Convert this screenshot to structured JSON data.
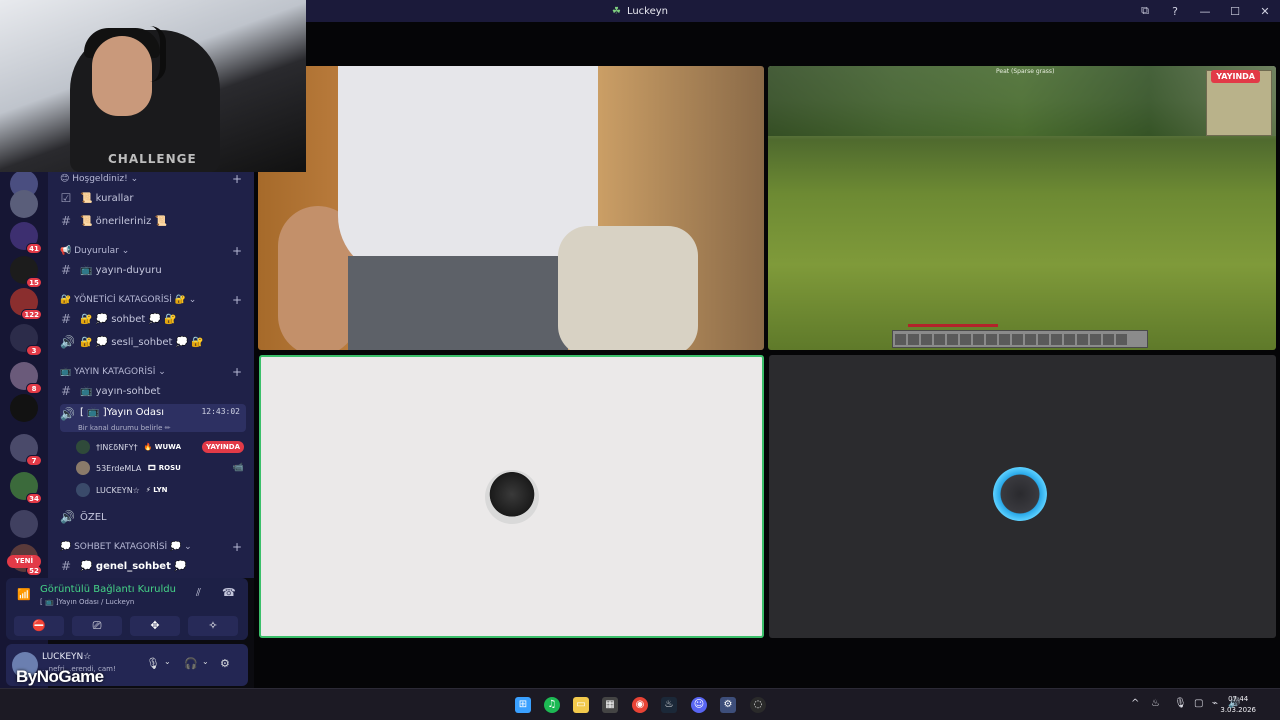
{
  "window": {
    "title": "Luckeyn",
    "controls": [
      "⧉",
      "?",
      "—",
      "☐",
      "✕"
    ]
  },
  "guilds": [
    {
      "badge": ""
    },
    {
      "badge": ""
    },
    {
      "badge": "41"
    },
    {
      "badge": "15"
    },
    {
      "badge": "122"
    },
    {
      "badge": "3"
    },
    {
      "badge": "8"
    },
    {
      "badge": ""
    },
    {
      "badge": "7"
    },
    {
      "badge": "34"
    },
    {
      "badge": ""
    },
    {
      "badge": "52"
    }
  ],
  "new_label": "YENİ",
  "sidebar": {
    "categories": [
      {
        "label": "😊 Hoşgeldiniz! ⌄",
        "plus": "+"
      },
      {
        "label": "📢 Duyurular ⌄",
        "plus": "+"
      },
      {
        "label": "🔐 YÖNETİCİ KATAGORİSİ 🔐 ⌄",
        "plus": "+"
      },
      {
        "label": "📺 YAYIN KATAGORİSİ ⌄",
        "plus": "+"
      },
      {
        "label": "💭 SOHBET KATAGORİSİ 💭 ⌄",
        "plus": "+"
      }
    ],
    "channels": [
      {
        "icon": "☑",
        "label": "📜 kurallar"
      },
      {
        "icon": "#",
        "label": "📜 önerileriniz 📜"
      },
      {
        "icon": "#",
        "label": "📺 yayın-duyuru"
      },
      {
        "icon": "#",
        "label": "🔐 💭 sohbet 💭 🔐"
      },
      {
        "icon": "🔊",
        "label": "🔐 💭 sesli_sohbet 💭 🔐"
      },
      {
        "icon": "#",
        "label": "📺 yayın-sohbet"
      },
      {
        "icon": "🔊",
        "label": "[ 📺 ]Yayın Odası",
        "timer": "12:43:02"
      },
      {
        "icon": "🔊",
        "label": "ÖZEL"
      },
      {
        "icon": "#",
        "label": "💭 genel_sohbet 💭"
      }
    ],
    "channel_status": "Bir kanal durumu belirle ✏",
    "members": [
      {
        "name": "†ΙΝƐδΝFΥ†",
        "tag": "🔥 WUWA",
        "live": "YAYINDA"
      },
      {
        "name": "53ErdeMLA",
        "tag": "🎞 ROSU",
        "cam": "📹"
      },
      {
        "name": "LUCKEYN☆",
        "tag": "⚡ LYN"
      }
    ]
  },
  "voice": {
    "status": "Görüntülü Bağlantı Kuruldu",
    "location": "[ 📺 ]Yayın Odası / Luckeyn",
    "buttons": [
      "⛔",
      "⎚",
      "✥",
      "✧"
    ]
  },
  "user": {
    "name": "LUCKEYN☆",
    "subtitle": "...nefri...erendi, cam!"
  },
  "watermark": "ByNoGame",
  "webcam_text": "CHALLENGE",
  "stream": {
    "hud_text": "Peat (Sparse grass)",
    "live_label": "YAYINDA"
  },
  "clock": {
    "time": "07:44",
    "date": "3.03.2026"
  },
  "colors": {
    "accent": "#e23a47",
    "voice_green": "#45d487",
    "speaking_border": "#3bbf6a",
    "sidebar_bg": "#1f2148"
  }
}
